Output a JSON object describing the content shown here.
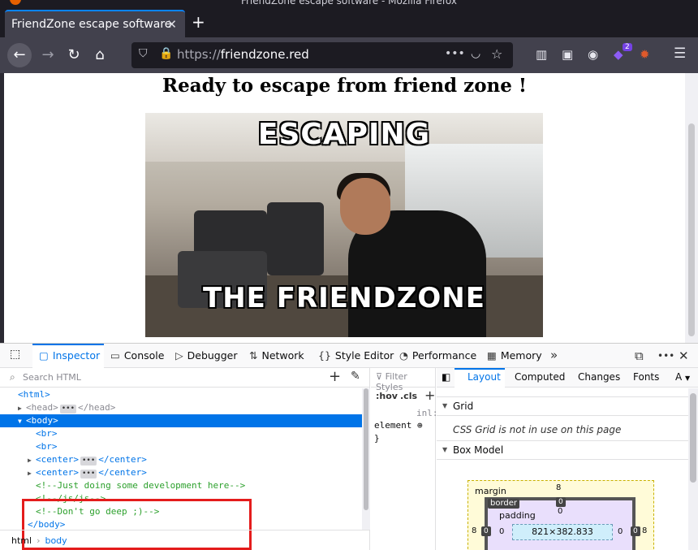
{
  "window": {
    "title": "FriendZone escape software - Mozilla Firefox"
  },
  "tab": {
    "label": "FriendZone escape software",
    "close_glyph": "✕",
    "new_tab_glyph": "+"
  },
  "navbar": {
    "url_scheme": "https://",
    "url_host": "friendzone.red",
    "back_glyph": "←",
    "forward_glyph": "→",
    "reload_glyph": "↻",
    "home_glyph": "⌂",
    "page_actions_glyph": "•••",
    "extension_badge": "2"
  },
  "page": {
    "heading": "Ready to escape from friend zone !",
    "gif_top_text": "ESCAPING",
    "gif_bottom_text": "THE FRIENDZONE"
  },
  "devtools": {
    "tabs": [
      "Inspector",
      "Console",
      "Debugger",
      "Network",
      "Style Editor",
      "Performance",
      "Memory"
    ],
    "search_placeholder": "Search HTML",
    "tree": {
      "html_open": "<html>",
      "head": "<head>",
      "head_close": "</head>",
      "body_open": "<body>",
      "br1": "<br>",
      "br2": "<br>",
      "center1_open": "<center>",
      "center1_close": "</center>",
      "center2_open": "<center>",
      "center2_close": "</center>",
      "comment1": "<!--Just doing some development here-->",
      "comment2": "<!--/js/js-->",
      "comment3": "<!--Don't go deep ;)-->",
      "body_close": "</body>",
      "collapsed_glyph": "•••"
    },
    "breadcrumbs": [
      "html",
      "body"
    ],
    "rules": {
      "filter_placeholder": "Filter Styles",
      "hov": ":hov",
      "cls": ".cls",
      "inline_label": "inl:",
      "element_label": "element",
      "close_brace": "}"
    },
    "layout": {
      "tabs": [
        "Layout",
        "Computed",
        "Changes",
        "Fonts",
        "A"
      ],
      "grid_title": "Grid",
      "grid_note": "CSS Grid is not in use on this page",
      "boxmodel_title": "Box Model",
      "margin_label": "margin",
      "border_label": "border",
      "padding_label": "padding",
      "margin_top": "8",
      "border_top": "0",
      "padding_top": "0",
      "margin_left": "8",
      "border_left": "0",
      "padding_left": "0",
      "padding_right": "0",
      "border_right": "0",
      "margin_right": "8",
      "content_size": "821×382.833"
    }
  }
}
